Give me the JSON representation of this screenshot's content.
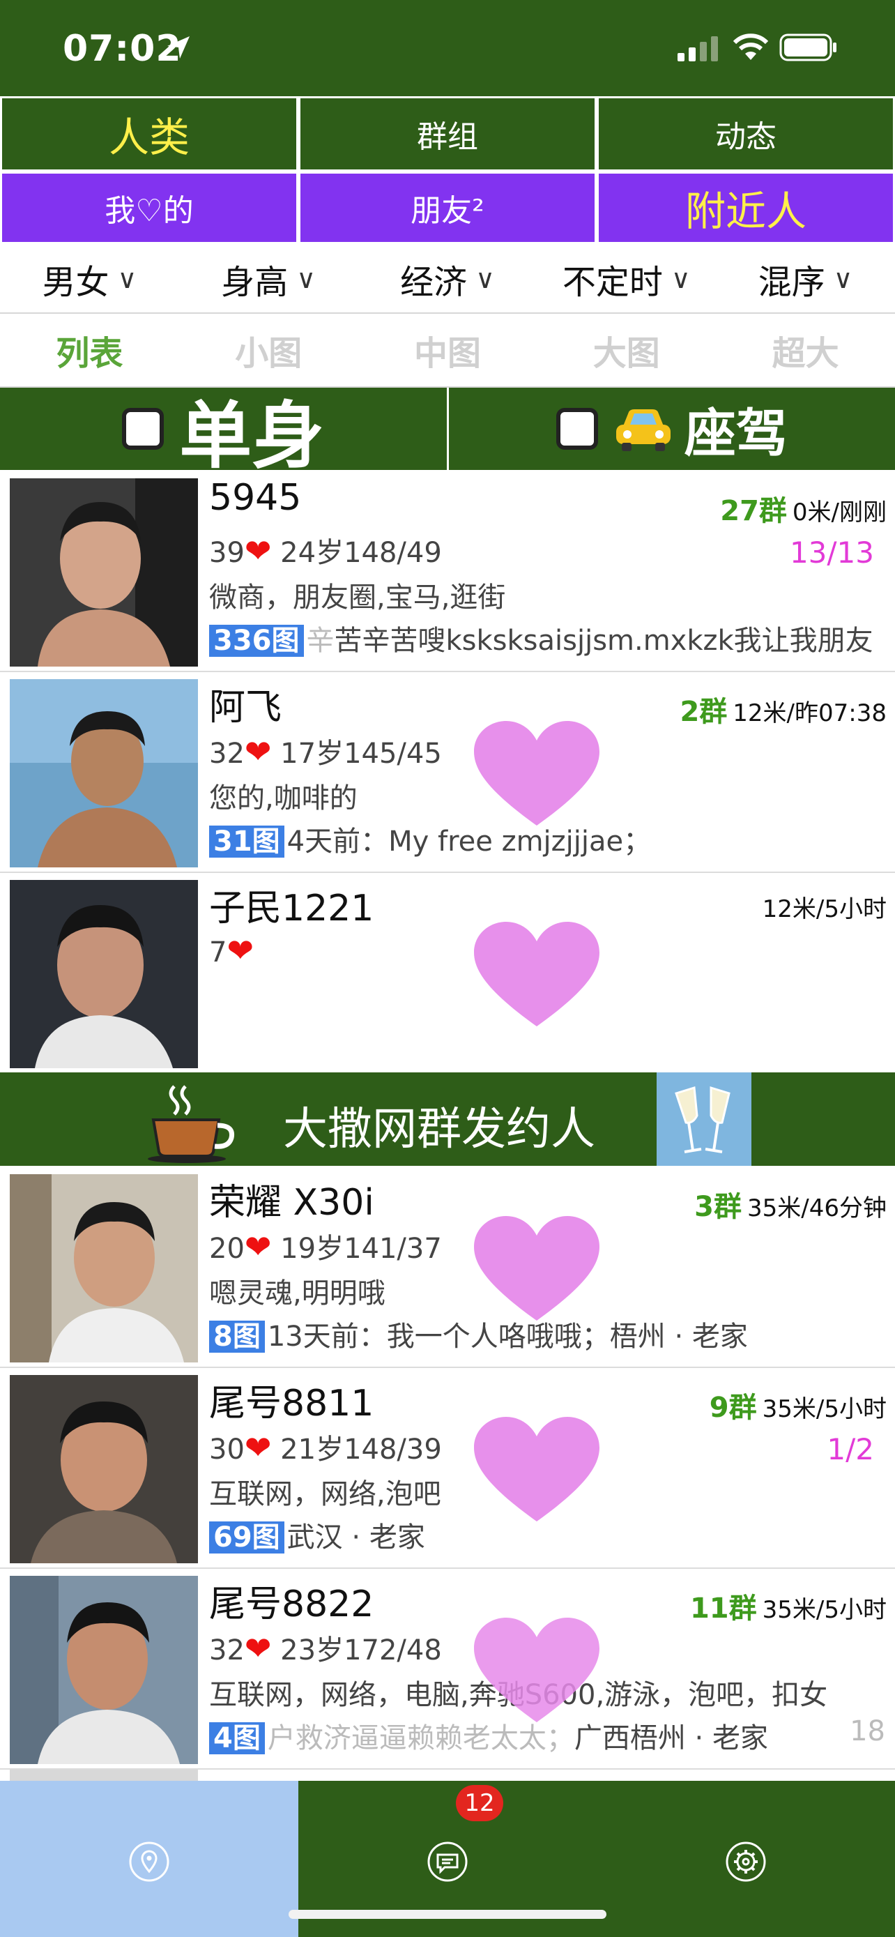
{
  "status": {
    "time": "07:02"
  },
  "nav_main": [
    {
      "label": "人类",
      "active": true
    },
    {
      "label": "群组",
      "active": false
    },
    {
      "label": "动态",
      "active": false
    }
  ],
  "nav_sub": [
    {
      "label": "我♡的",
      "active": false
    },
    {
      "label": "朋友²",
      "active": false
    },
    {
      "label": "附近人",
      "active": true
    }
  ],
  "filters": [
    "男女",
    "身高",
    "经济",
    "不定时",
    "混序"
  ],
  "filter_chevron": "∨",
  "views": [
    "列表",
    "小图",
    "中图",
    "大图",
    "超大"
  ],
  "toggles": {
    "single_label": "单身",
    "driver_label": "座驾"
  },
  "users": [
    {
      "name": "5945",
      "groups": "27群",
      "distance": "0米/刚刚",
      "ratio": "13/13",
      "level": "39",
      "age_line": "24岁148/49",
      "tags": "微商，朋友圈,宝马,逛街",
      "photos": "336图",
      "faded_prefix": "辛",
      "message": "苦辛苦嗖ksksksaisjjsm.mxkzk我让我朋友"
    },
    {
      "name": "阿飞",
      "groups": "2群",
      "distance": "12米/昨07:38",
      "level": "32",
      "age_line": "17岁145/45",
      "tags": "您的,咖啡的",
      "photos": "31图",
      "message": "4天前：My free zmjzjjjae；"
    },
    {
      "name": "子民1221",
      "distance": "12米/5小时",
      "level": "7"
    },
    {
      "name": "荣耀 X30i",
      "groups": "3群",
      "distance": "35米/46分钟",
      "level": "20",
      "age_line": "19岁141/37",
      "tags": "嗯灵魂,明明哦",
      "photos": "8图",
      "message": "13天前：我一个人咯哦哦；梧州 · 老家"
    },
    {
      "name": "尾号8811",
      "groups": "9群",
      "distance": "35米/5小时",
      "ratio": "1/2",
      "level": "30",
      "age_line": "21岁148/39",
      "tags": "互联网，网络,泡吧",
      "photos": "69图",
      "message": "武汉 · 老家"
    },
    {
      "name": "尾号8822",
      "groups": "11群",
      "distance": "35米/5小时",
      "level": "32",
      "age_line": "23岁172/48",
      "tags": "互联网，网络，电脑,奔驰S600,游泳，泡吧，扣女",
      "photos": "4图",
      "faded_prefix": "户救济逼逼赖赖老太太；",
      "message": "广西梧州 · 老家",
      "tail": "18"
    }
  ],
  "banner": {
    "title": "大撒网群发约人"
  },
  "tabbar": {
    "badge_count": "12"
  },
  "colors": {
    "dark_green": "#2e5d18",
    "purple": "#8233f0",
    "yellow": "#fff04a",
    "group_green": "#3e9a1d",
    "magenta": "#e23ad7",
    "photo_badge": "#3c7fe4",
    "active_tab": "#a9c9f1"
  }
}
